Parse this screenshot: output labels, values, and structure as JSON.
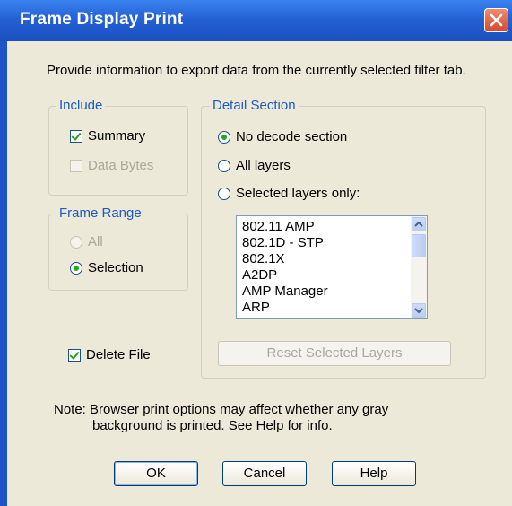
{
  "window": {
    "title": "Frame Display Print"
  },
  "instruction": "Provide information to export data from the currently selected filter tab.",
  "include": {
    "legend": "Include",
    "summary": {
      "label": "Summary",
      "checked": true
    },
    "data_bytes": {
      "label": "Data Bytes",
      "checked": false,
      "disabled": true
    }
  },
  "frame_range": {
    "legend": "Frame Range",
    "all": {
      "label": "All",
      "disabled": true
    },
    "selection": {
      "label": "Selection",
      "selected": true
    }
  },
  "detail_section": {
    "legend": "Detail Section",
    "options": [
      {
        "label": "No decode section",
        "selected": true
      },
      {
        "label": "All layers",
        "selected": false
      },
      {
        "label": "Selected layers only:",
        "selected": false
      }
    ],
    "layers": [
      "802.11 AMP",
      "802.1D - STP",
      "802.1X",
      "A2DP",
      "AMP Manager",
      "ARP"
    ],
    "reset_button": "Reset Selected Layers"
  },
  "delete_file": {
    "label": "Delete File",
    "checked": true
  },
  "note": {
    "line1": "Note:  Browser print options may affect whether any gray",
    "line2": "background is printed.  See Help for info."
  },
  "buttons": {
    "ok": "OK",
    "cancel": "Cancel",
    "help": "Help"
  },
  "icons": {
    "close": "close-icon",
    "scroll_up": "scroll-up-icon",
    "scroll_down": "scroll-down-icon"
  },
  "colors": {
    "title_bar": "#2461d6",
    "dialog_bg": "#ece9d8",
    "legend_text": "#1c5ac4",
    "close_button": "#d9482a"
  }
}
